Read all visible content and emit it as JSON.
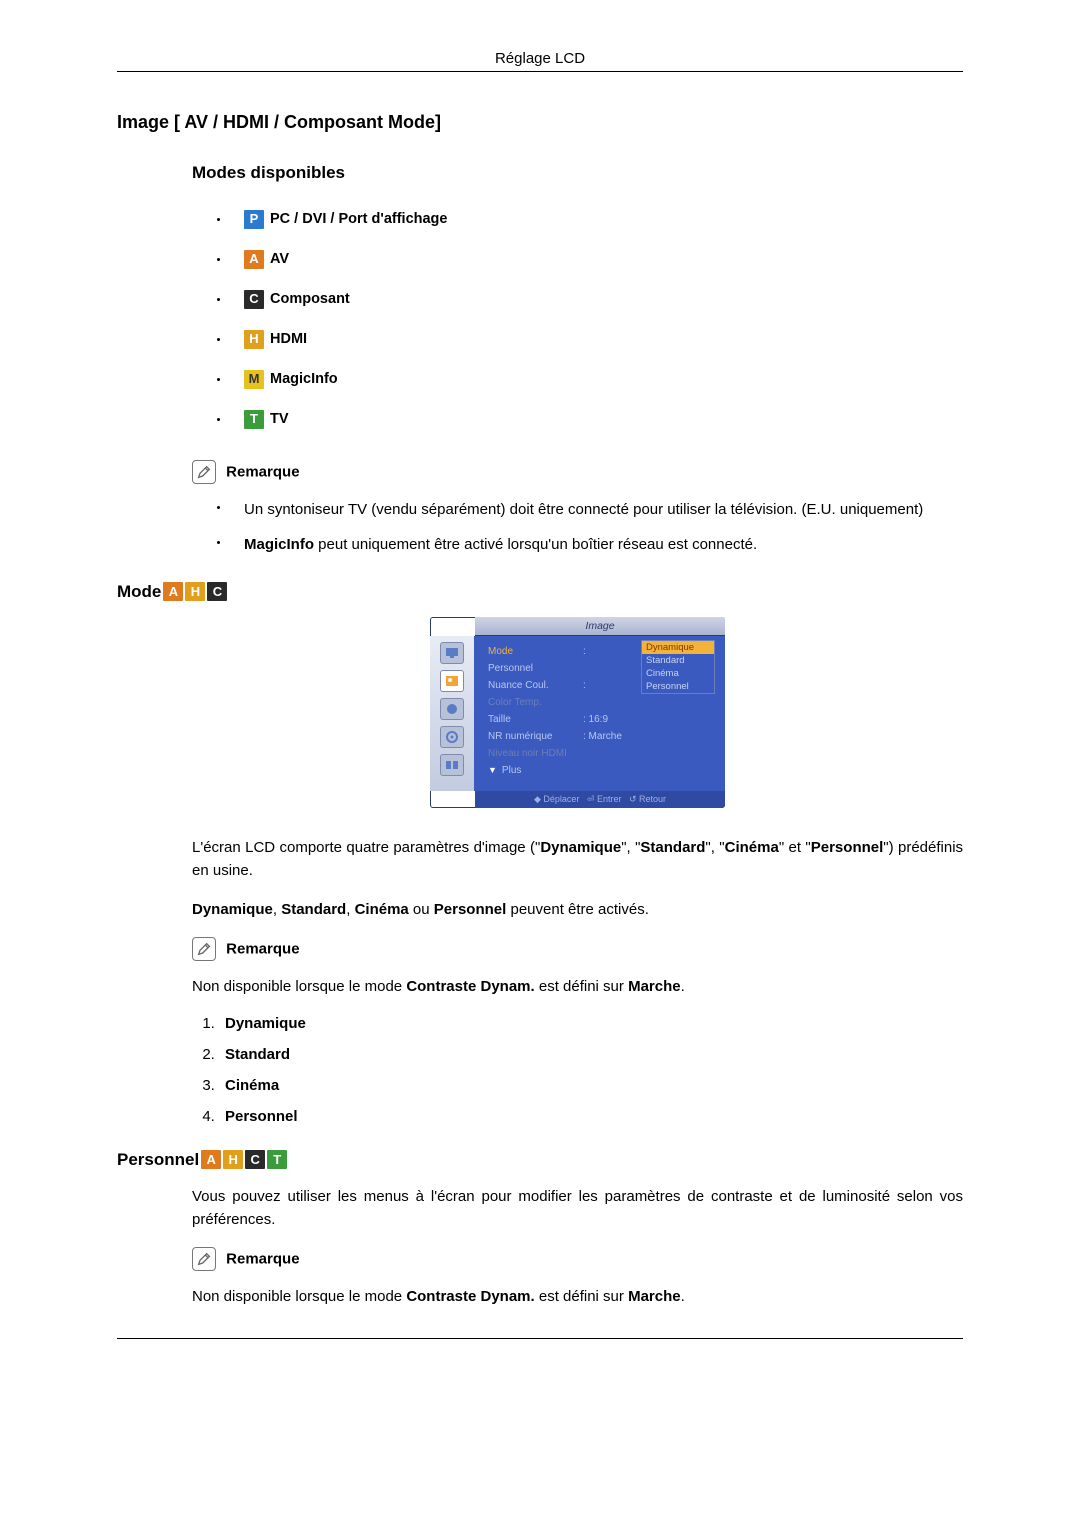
{
  "header": "Réglage LCD",
  "image_section_title": "Image [ AV / HDMI / Composant Mode]",
  "modes_title": "Modes disponibles",
  "icons": {
    "p": "P",
    "a": "A",
    "c": "C",
    "h": "H",
    "m": "M",
    "t": "T"
  },
  "modes_list": {
    "pc": "PC / DVI / Port d'affichage",
    "av": "AV",
    "composant": "Composant",
    "hdmi": "HDMI",
    "magicinfo": "MagicInfo",
    "tv": "TV"
  },
  "remark_label": "Remarque",
  "remarks1": {
    "tv": "Un syntoniseur TV (vendu séparément) doit être connecté pour utiliser la télévision. (E.U. uniquement)",
    "magicinfo_b": "MagicInfo",
    "magicinfo_rest": " peut uniquement être activé lorsqu'un boîtier réseau est connecté."
  },
  "mode_heading": "Mode",
  "osd": {
    "title": "Image",
    "rows": {
      "mode": "Mode",
      "personnel": "Personnel",
      "nuance": "Nuance Coul.",
      "colortemp": "Color Temp.",
      "taille": "Taille",
      "taille_val": ": 16:9",
      "nr": "NR numérique",
      "nr_val": ": Marche",
      "hdmi": "Niveau noir HDMI",
      "plus": "Plus"
    },
    "options": {
      "dynamique": "Dynamique",
      "standard": "Standard",
      "cinema": "Cinéma",
      "personnel": "Personnel"
    },
    "footer": {
      "move": "Déplacer",
      "enter": "Entrer",
      "return": "Retour"
    }
  },
  "mode_paragraphs": {
    "p1_a": "L'écran LCD comporte quatre paramètres d'image (\"",
    "p1_b": "Dynamique",
    "p1_c": "\", \"",
    "p1_d": "Standard",
    "p1_e": "\", \"",
    "p1_f": "Cinéma",
    "p1_g": "\" et \"",
    "p1_h": "Personnel",
    "p1_i": "\") prédéfinis en usine.",
    "p2_a": "Dynamique",
    "p2_b": ", ",
    "p2_c": "Standard",
    "p2_d": ", ",
    "p2_e": "Cinéma",
    "p2_f": " ou ",
    "p2_g": "Personnel",
    "p2_h": " peuvent être activés.",
    "p3_a": "Non disponible lorsque le mode ",
    "p3_b": "Contraste Dynam.",
    "p3_c": " est défini sur ",
    "p3_d": "Marche",
    "p3_e": "."
  },
  "num_list": {
    "1": "Dynamique",
    "2": "Standard",
    "3": "Cinéma",
    "4": "Personnel"
  },
  "personnel_heading": "Personnel",
  "personnel_para": "Vous pouvez utiliser les menus à l'écran pour modifier les paramètres de contraste et de luminosité selon vos préférences.",
  "personnel_note": {
    "a": "Non disponible lorsque le mode ",
    "b": "Contraste Dynam.",
    "c": " est défini sur ",
    "d": "Marche",
    "e": "."
  }
}
